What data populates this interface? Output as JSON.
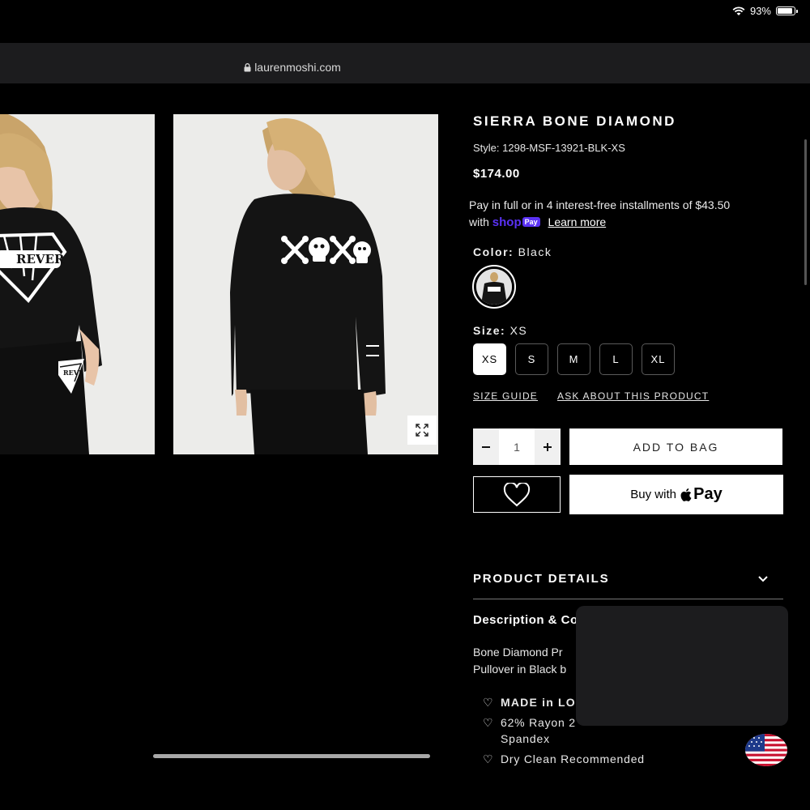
{
  "status_bar": {
    "battery": "93%",
    "battery_level": 0.93
  },
  "browser": {
    "url": "laurenmoshi.com"
  },
  "product": {
    "title": "SIERRA BONE DIAMOND",
    "style": "Style: 1298-MSF-13921-BLK-XS",
    "price": "$174.00",
    "installments_line1": "Pay in full or in 4 interest-free installments of $43.50",
    "installments_with": "with",
    "shop_word": "shop",
    "shop_pay_badge": "Pay",
    "learn_more": "Learn more",
    "color_label": "Color:",
    "color_value": "Black",
    "size_label": "Size:",
    "size_value": "XS",
    "sizes": [
      "XS",
      "S",
      "M",
      "L",
      "XL"
    ],
    "selected_size": "XS",
    "size_guide": "SIZE GUIDE",
    "ask_about": "ASK ABOUT THIS PRODUCT",
    "quantity": "1",
    "add_to_bag": "ADD TO BAG",
    "buy_with": "Buy with",
    "apple_pay": "Pay"
  },
  "details": {
    "heading": "PRODUCT DETAILS",
    "desc_heading": "Description & Co",
    "desc_line1": "Bone Diamond Pr",
    "desc_line2": "Pullover in Black b",
    "bullet1": "MADE in LO",
    "bullet2_line1": "62% Rayon 2",
    "bullet2_line2": "Spandex",
    "bullet3": "Dry Clean Recommended"
  },
  "images": {
    "front_text": "REVER",
    "pants_text": "REVE"
  },
  "colors": {
    "background": "#000000",
    "shop_pay": "#5a31f4"
  }
}
